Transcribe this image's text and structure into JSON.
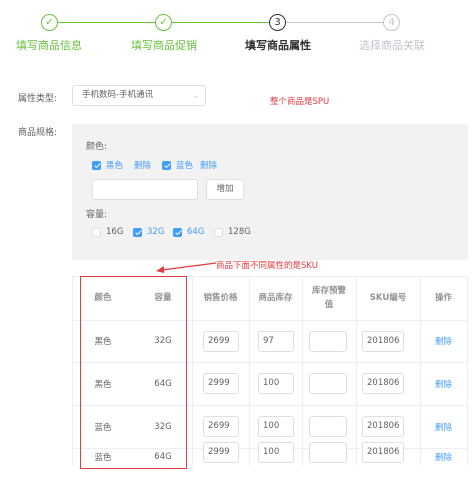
{
  "steps": [
    {
      "title": "填写商品信息",
      "status": "done",
      "mark": "✓"
    },
    {
      "title": "填写商品促销",
      "status": "done",
      "mark": "✓"
    },
    {
      "title": "填写商品属性",
      "status": "active",
      "mark": "3"
    },
    {
      "title": "选择商品关联",
      "status": "wait",
      "mark": "4"
    }
  ],
  "form": {
    "attr_type_label": "属性类型:",
    "attr_type_value": "手机数码-手机通讯",
    "spec_label": "商品规格:"
  },
  "annotations": {
    "spu": "整个商品是SPU",
    "sku": "商品下面不同属性的是SKU"
  },
  "spec": {
    "color_label": "颜色:",
    "colors": [
      {
        "label": "黑色",
        "checked": true,
        "delete": "删除"
      },
      {
        "label": "蓝色",
        "checked": true,
        "delete": "删除"
      }
    ],
    "add_input_value": "",
    "add_button": "增加",
    "capacity_label": "容量:",
    "capacities": [
      {
        "label": "16G",
        "checked": false
      },
      {
        "label": "32G",
        "checked": true
      },
      {
        "label": "64G",
        "checked": true
      },
      {
        "label": "128G",
        "checked": false
      }
    ]
  },
  "table": {
    "headers": [
      "颜色",
      "容量",
      "销售价格",
      "商品库存",
      "库存预警值",
      "SKU编号",
      "操作"
    ],
    "rows": [
      {
        "color": "黑色",
        "capacity": "32G",
        "price": "2699",
        "stock": "97",
        "warn": "",
        "sku": "201806",
        "action": "删除"
      },
      {
        "color": "黑色",
        "capacity": "64G",
        "price": "2999",
        "stock": "100",
        "warn": "",
        "sku": "201806",
        "action": "删除"
      },
      {
        "color": "蓝色",
        "capacity": "32G",
        "price": "2699",
        "stock": "100",
        "warn": "",
        "sku": "201806",
        "action": "删除"
      },
      {
        "color": "蓝色",
        "capacity": "64G",
        "price": "2999",
        "stock": "100",
        "warn": "",
        "sku": "201806",
        "action": "删除"
      }
    ]
  },
  "colors": {
    "success": "#67c23a",
    "primary": "#409eff",
    "annotation": "#e4393c"
  }
}
